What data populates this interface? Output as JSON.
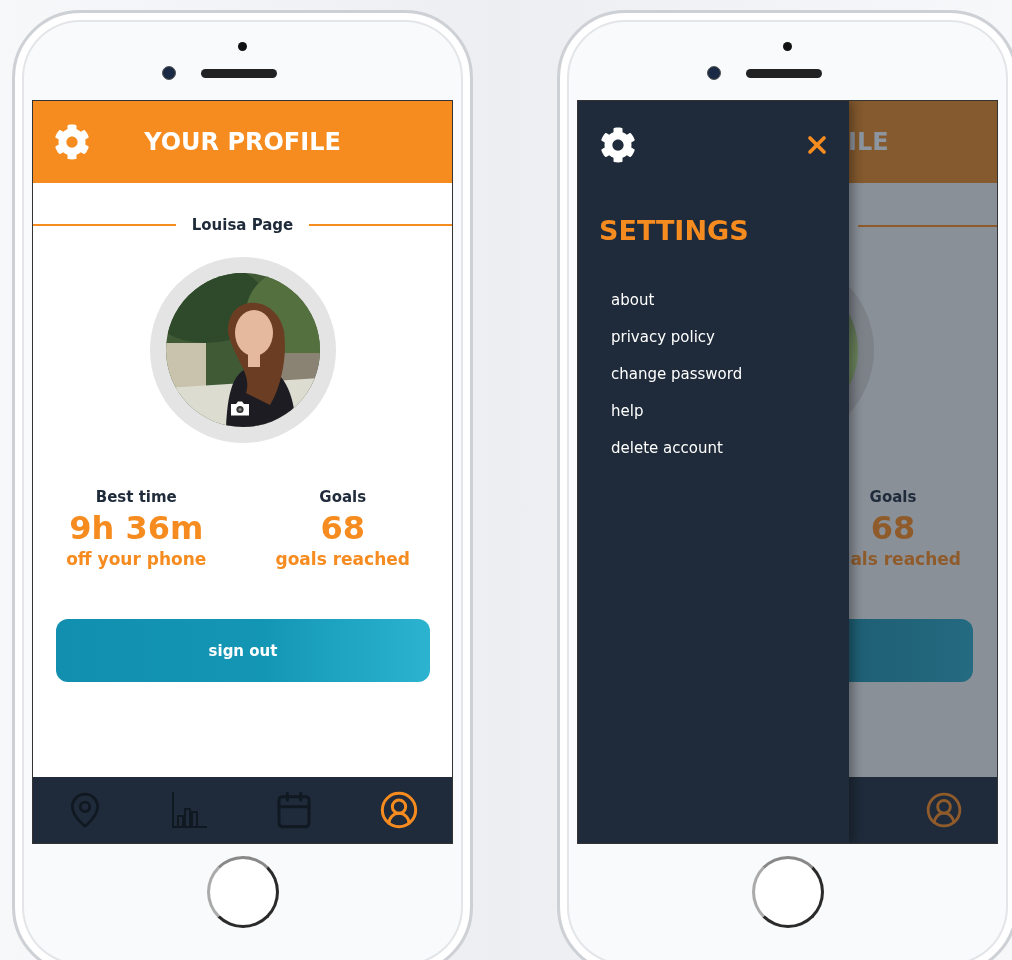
{
  "screens": [
    {
      "kind": "profile",
      "header": {
        "title": "YOUR PROFILE"
      },
      "user_name": "Louisa Page",
      "avatar": {
        "kind": "picture"
      },
      "stats": [
        {
          "label": "Best time",
          "value": "9h 36m",
          "caption": "off your phone"
        },
        {
          "label": "Goals",
          "value": "68",
          "caption": "goals reached"
        }
      ],
      "sign_out_button": "sign out",
      "nav": [
        {
          "selected": false
        },
        {
          "selected": false
        },
        {
          "selected": false
        },
        {
          "selected": true
        }
      ]
    },
    {
      "kind": "settings",
      "drawer": {
        "title": "SETTINGS",
        "items": [
          "about",
          "privacy policy",
          "change password",
          "help",
          "delete account"
        ]
      },
      "background": {
        "header_title": "ILE",
        "stat_label": "Goals",
        "stat_value": "68",
        "stat_caption": "als reached",
        "nav": [
          {
            "selected": true
          }
        ]
      }
    }
  ]
}
